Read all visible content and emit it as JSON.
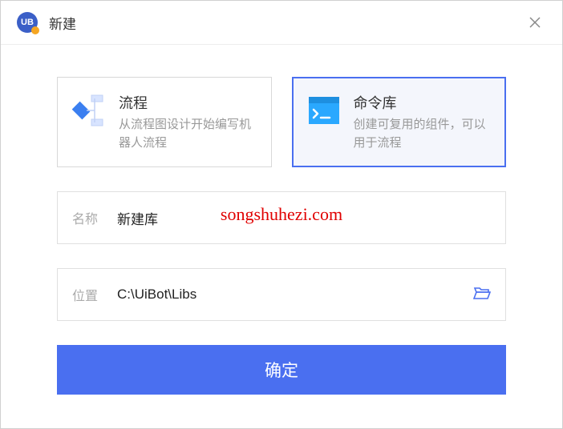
{
  "window": {
    "title": "新建",
    "logo_text": "UB"
  },
  "cards": {
    "flow": {
      "title": "流程",
      "desc": "从流程图设计开始编写机器人流程"
    },
    "lib": {
      "title": "命令库",
      "desc": "创建可复用的组件，可以用于流程"
    }
  },
  "fields": {
    "name_label": "名称",
    "name_value": "新建库",
    "path_label": "位置",
    "path_value": "C:\\UiBot\\Libs"
  },
  "buttons": {
    "confirm": "确定"
  },
  "watermark": "songshuhezi.com"
}
